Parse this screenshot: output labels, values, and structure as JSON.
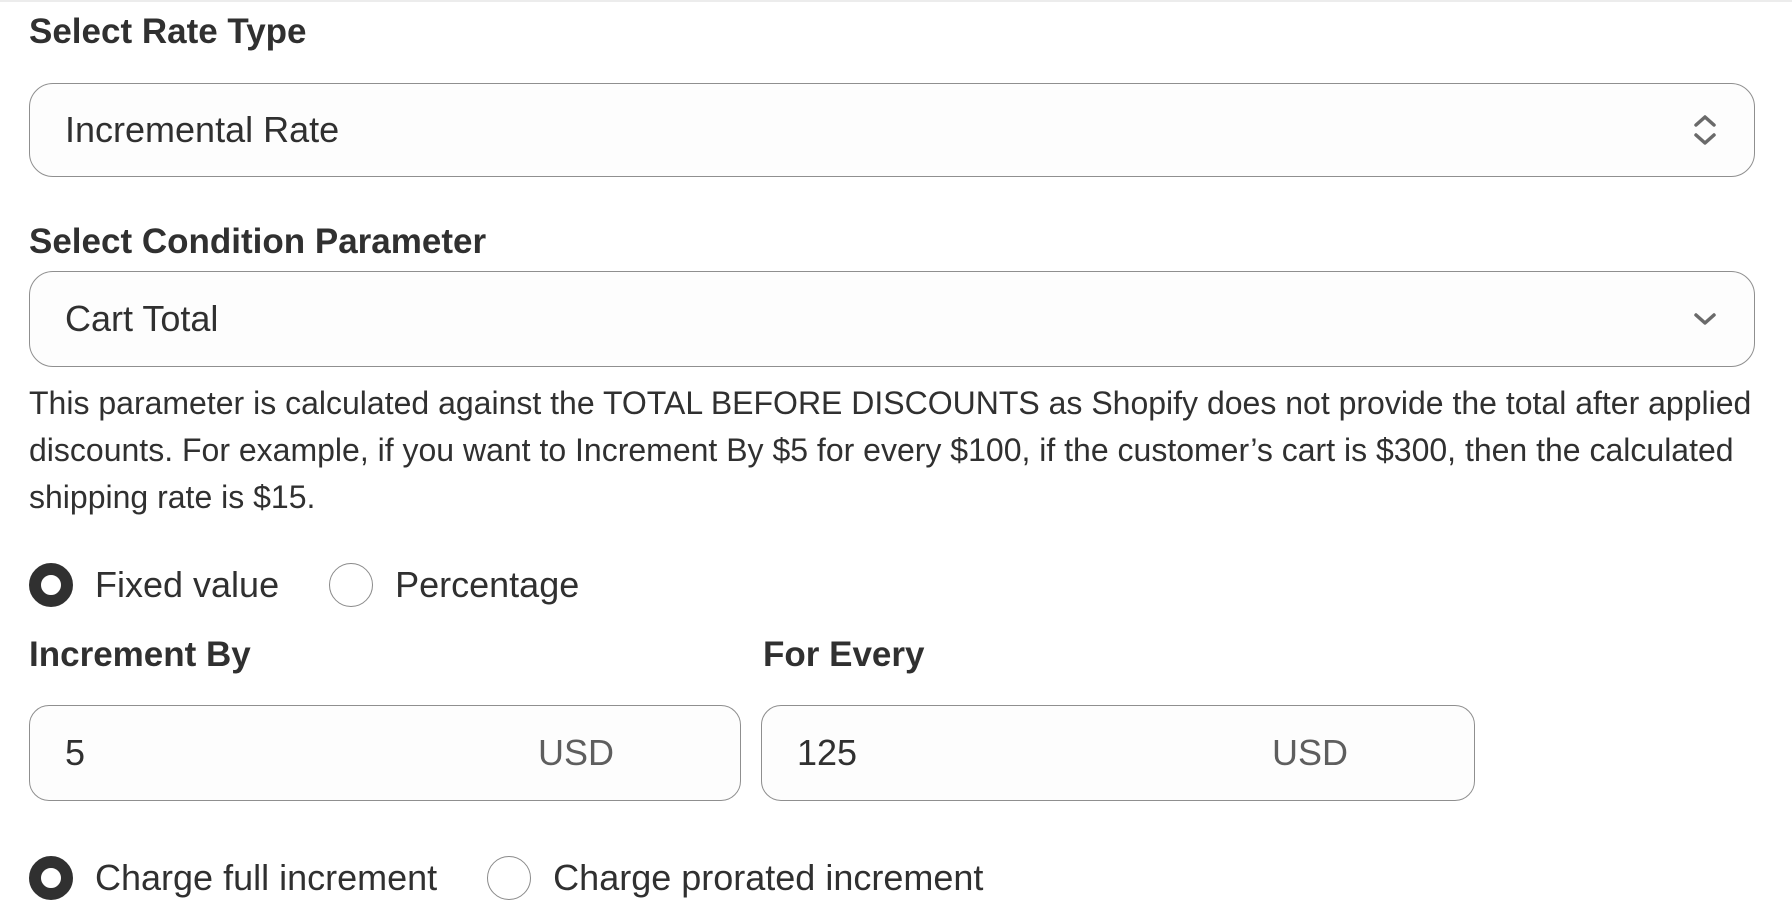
{
  "rate_type": {
    "label": "Select Rate Type",
    "selected": "Incremental Rate",
    "icon": "chevron-up-down-icon"
  },
  "condition_parameter": {
    "label": "Select Condition Parameter",
    "selected": "Cart Total",
    "icon": "chevron-down-icon",
    "help_text": "This parameter is calculated against the TOTAL BEFORE DISCOUNTS as Shopify does not provide the total after applied discounts. For example, if you want to Increment By $5 for every $100, if the customer’s cart is $300, then the calculated shipping rate is $15."
  },
  "value_type": {
    "options": [
      {
        "label": "Fixed value",
        "checked": true
      },
      {
        "label": "Percentage",
        "checked": false
      }
    ]
  },
  "increment_by": {
    "label": "Increment By",
    "value": "5",
    "suffix": "USD"
  },
  "for_every": {
    "label": "For Every",
    "value": "125",
    "suffix": "USD"
  },
  "charge_type": {
    "options": [
      {
        "label": "Charge full increment",
        "checked": true
      },
      {
        "label": "Charge prorated increment",
        "checked": false
      }
    ]
  }
}
